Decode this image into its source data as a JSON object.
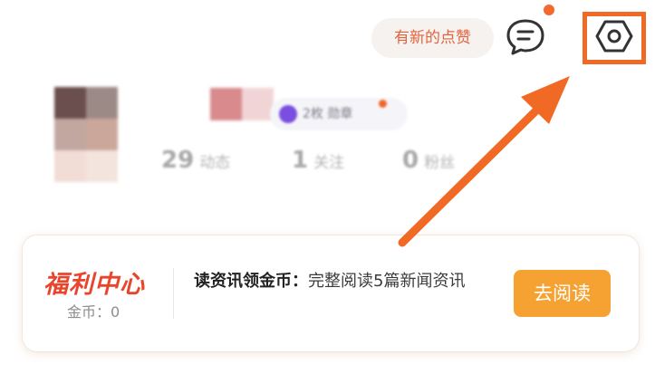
{
  "topbar": {
    "likes_pill": "有新的点赞",
    "message_icon": "chat-bubble-icon",
    "settings_icon": "hexagon-gear-icon",
    "settings_highlight_color": "#f06a25"
  },
  "profile": {
    "badge_text": "2枚 勋章",
    "stats": [
      {
        "value": "29",
        "label": "动态"
      },
      {
        "value": "1",
        "label": "关注"
      },
      {
        "value": "0",
        "label": "粉丝"
      }
    ]
  },
  "welfare": {
    "title": "福利中心",
    "coins": "金币：0",
    "task_title": "读资讯领金币：",
    "task_desc": "完整阅读5篇新闻资讯",
    "button_label": "去阅读",
    "button_color": "#f5a232"
  },
  "annotation": {
    "arrow_color": "#f06a25"
  }
}
